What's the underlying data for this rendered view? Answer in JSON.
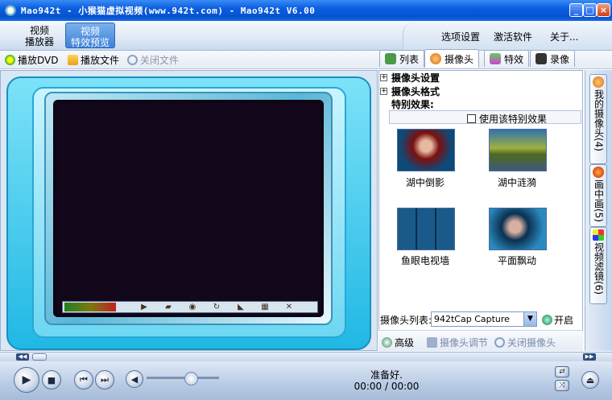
{
  "window": {
    "title": "Mao942t - 小猴猫虚拟视频(www.942t.com) - Mao942t V6.00",
    "controls": [
      "minimize",
      "maximize",
      "close"
    ]
  },
  "nav": {
    "tabs": [
      {
        "line1": "视频",
        "line2": "播放器",
        "active": false
      },
      {
        "line1": "视频",
        "line2": "特效预览",
        "active": true
      }
    ],
    "right": [
      "选项设置",
      "激活软件",
      "关于..."
    ]
  },
  "toolbar": {
    "play_dvd": "播放DVD",
    "play_file": "播放文件",
    "close_file": "关闭文件"
  },
  "right_tabs": [
    {
      "label": "列表",
      "icon": "list-icon"
    },
    {
      "label": "摄像头",
      "icon": "webcam-icon",
      "active": true
    },
    {
      "label": "特效",
      "icon": "effects-icon"
    },
    {
      "label": "录像",
      "icon": "record-icon"
    }
  ],
  "panel": {
    "camera_settings": "摄像头设置",
    "camera_format": "摄像头格式",
    "special_effects": "特别效果:",
    "use_effect": "使用该特别效果",
    "effects": [
      {
        "label": "湖中倒影",
        "icon": "lake-reflection-thumb"
      },
      {
        "label": "湖中涟漪",
        "icon": "lake-ripple-thumb"
      },
      {
        "label": "鱼眼电视墙",
        "icon": "fisheye-tv-wall-thumb"
      },
      {
        "label": "平面飘动",
        "icon": "plane-flutter-thumb"
      }
    ],
    "cam_list_label": "摄像头列表:",
    "cam_selected": "942tCap Capture",
    "open": "开启",
    "advanced": "高级",
    "cam_adjust": "摄像头调节",
    "close_cam": "关闭摄像头"
  },
  "side_tabs": [
    {
      "label": "我的摄像头(4)",
      "icon": "my-camera-icon"
    },
    {
      "label": "画中画(5)",
      "icon": "pip-icon"
    },
    {
      "label": "视频滤镜(6)",
      "icon": "filter-icon"
    }
  ],
  "player": {
    "status": "准备好.",
    "time": "00:00 / 00:00"
  },
  "colors": {
    "title_bar": "#0a5ee0",
    "frame_cyan": "#20b8e4",
    "screen": "#13071c"
  }
}
